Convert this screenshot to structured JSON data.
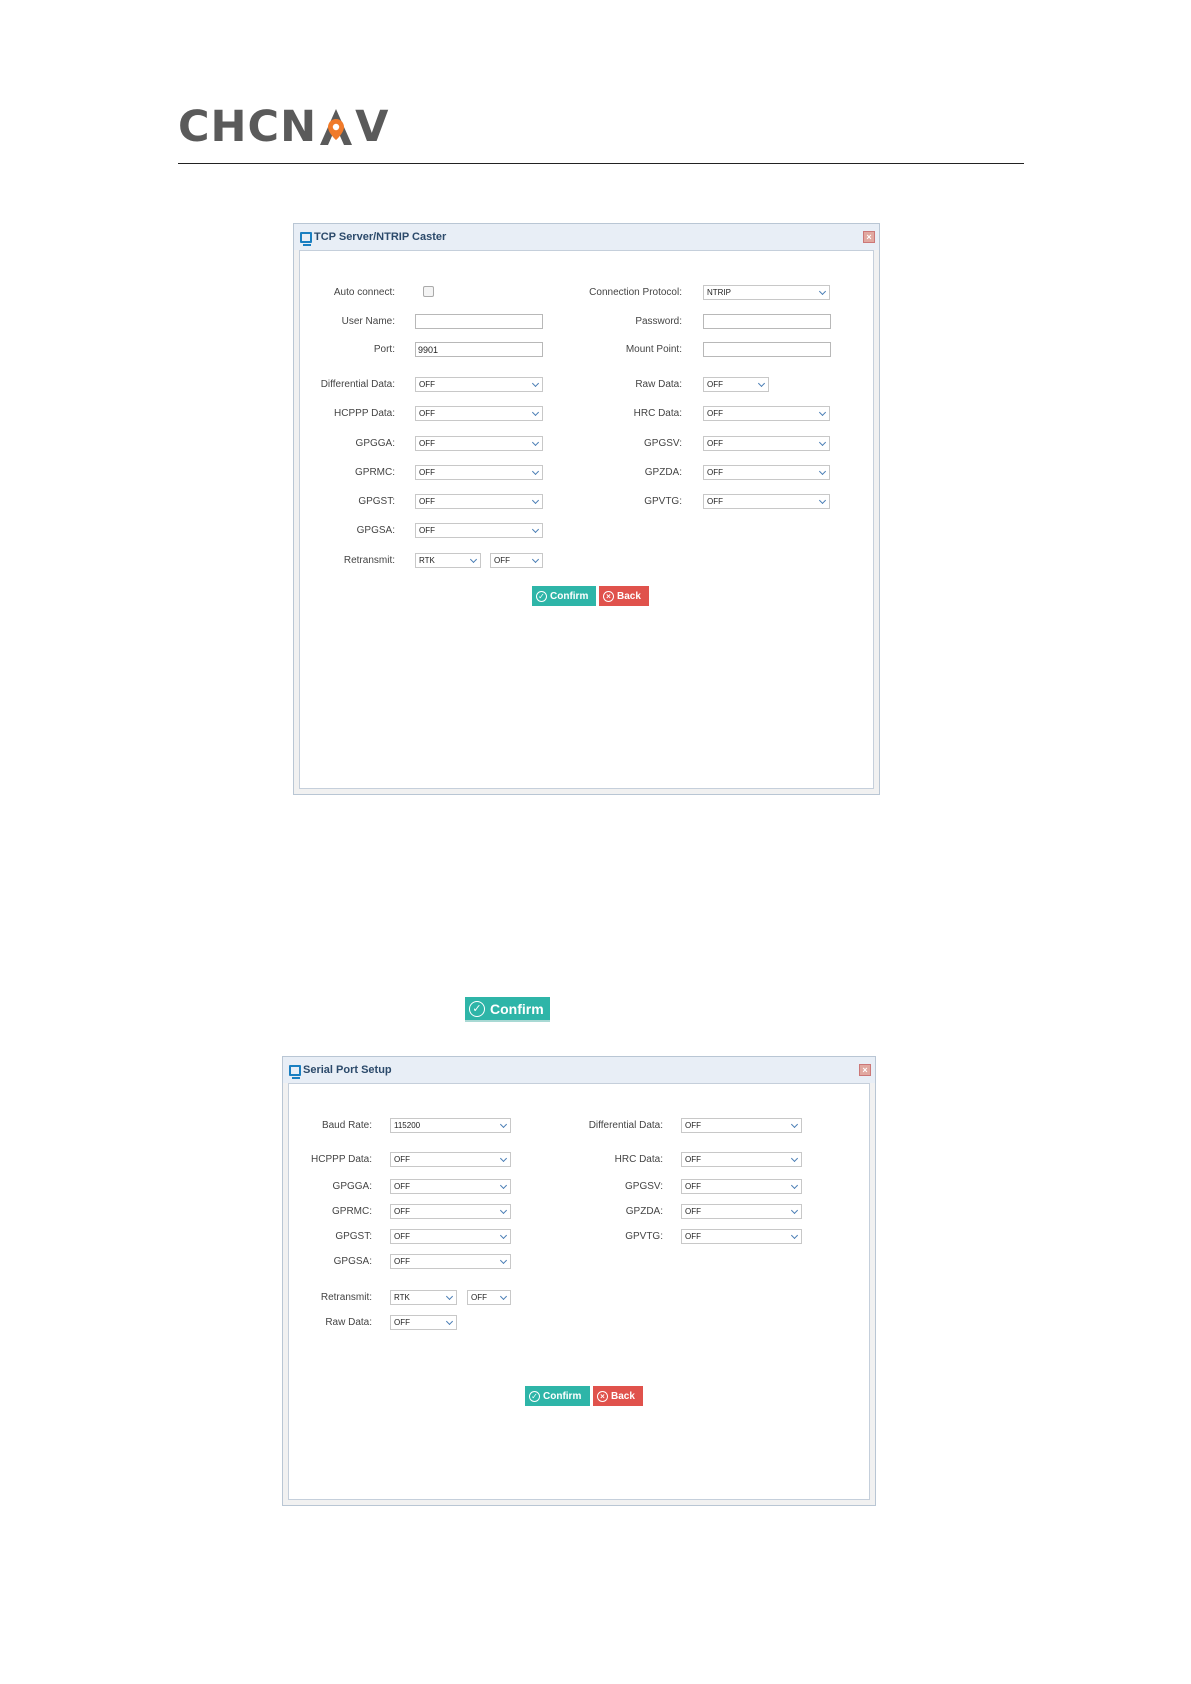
{
  "header": {
    "logo_prefix": "CHCN",
    "logo_suffix": "V",
    "logo_brand": "CHCNAV",
    "accent_color": "#f07a2a",
    "text_color": "#5a5a5a"
  },
  "tcp_dialog": {
    "title": "TCP Server/NTRIP Caster",
    "title_icon": "monitor-icon",
    "close_icon": "close-icon",
    "labels": {
      "auto_connect": "Auto connect:",
      "connection_protocol": "Connection Protocol:",
      "user_name": "User Name:",
      "password": "Password:",
      "port": "Port:",
      "mount_point": "Mount Point:",
      "differential_data": "Differential Data:",
      "raw_data": "Raw Data:",
      "hcppp_data": "HCPPP Data:",
      "hrc_data": "HRC Data:",
      "gpgga": "GPGGA:",
      "gpgsv": "GPGSV:",
      "gprmc": "GPRMC:",
      "gpzda": "GPZDA:",
      "gpgst": "GPGST:",
      "gpvtg": "GPVTG:",
      "gpgsa": "GPGSA:",
      "retransmit": "Retransmit:"
    },
    "values": {
      "connection_protocol": "NTRIP",
      "user_name": "",
      "password": "",
      "port": "9901",
      "mount_point": "",
      "differential_data": "OFF",
      "raw_data": "OFF",
      "hcppp_data": "OFF",
      "hrc_data": "OFF",
      "gpgga": "OFF",
      "gpgsv": "OFF",
      "gprmc": "OFF",
      "gpzda": "OFF",
      "gpgst": "OFF",
      "gpvtg": "OFF",
      "gpgsa": "OFF",
      "retransmit_source": "RTK",
      "retransmit_state": "OFF",
      "auto_connect_checked": false
    },
    "buttons": {
      "confirm": "Confirm",
      "back": "Back"
    }
  },
  "standalone_button": {
    "label": "Confirm"
  },
  "serial_dialog": {
    "title": "Serial Port Setup",
    "title_icon": "monitor-icon",
    "close_icon": "close-icon",
    "labels": {
      "baud_rate": "Baud Rate:",
      "differential_data": "Differential Data:",
      "hcppp_data": "HCPPP Data:",
      "hrc_data": "HRC Data:",
      "gpgga": "GPGGA:",
      "gpgsv": "GPGSV:",
      "gprmc": "GPRMC:",
      "gpzda": "GPZDA:",
      "gpgst": "GPGST:",
      "gpvtg": "GPVTG:",
      "gpgsa": "GPGSA:",
      "retransmit": "Retransmit:",
      "raw_data": "Raw Data:"
    },
    "values": {
      "baud_rate": "115200",
      "differential_data": "OFF",
      "hcppp_data": "OFF",
      "hrc_data": "OFF",
      "gpgga": "OFF",
      "gpgsv": "OFF",
      "gprmc": "OFF",
      "gpzda": "OFF",
      "gpgst": "OFF",
      "gpvtg": "OFF",
      "gpgsa": "OFF",
      "retransmit_source": "RTK",
      "retransmit_state": "OFF",
      "raw_data": "OFF"
    },
    "buttons": {
      "confirm": "Confirm",
      "back": "Back"
    }
  },
  "colors": {
    "confirm": "#2eb5a8",
    "back": "#e0524c",
    "title_bar": "#e8eef6",
    "icon_blue": "#1a7fc1"
  }
}
